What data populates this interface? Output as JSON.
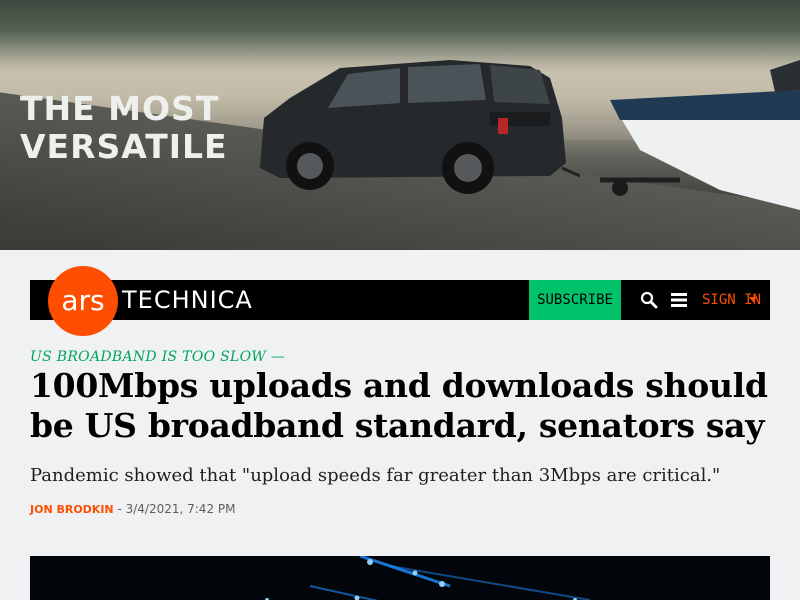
{
  "ad": {
    "headline_line1": "THE MOST",
    "headline_line2": "VERSATILE"
  },
  "header": {
    "logo_ars": "ars",
    "logo_technica": "TECHNICA",
    "subscribe_label": "SUBSCRIBE",
    "signin_label": "SIGN IN",
    "colors": {
      "brand_orange": "#ff4e00",
      "subscribe_green": "#00c26b",
      "bar": "#000000"
    }
  },
  "article": {
    "kicker": "US BROADBAND IS TOO SLOW —",
    "title": "100Mbps uploads and downloads should be US broadband standard, senators say",
    "dek": "Pandemic showed that \"upload speeds far greater than 3Mbps are critical.\"",
    "author": "JON BRODKIN",
    "byline_separator": " - ",
    "date": "3/4/2021, 7:42 PM"
  }
}
